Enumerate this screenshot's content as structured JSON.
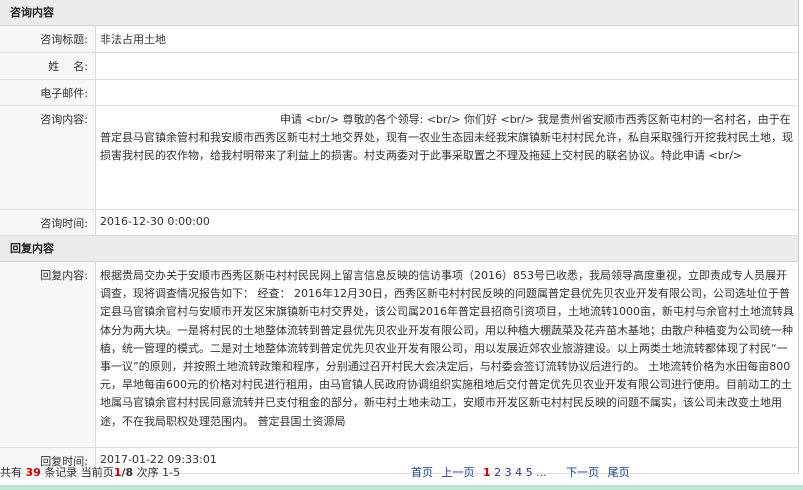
{
  "consult_section": {
    "header": "咨询内容",
    "title_label": "咨询标题:",
    "title_value": "非法占用土地",
    "name_label": "姓    名:",
    "name_value": "",
    "email_label": "电子邮件:",
    "email_value": "",
    "content_label": "咨询内容:",
    "content_value": "申请 <br/> 尊敬的各个领导: <br/> 你们好 <br/> 我是贵州省安顺市西秀区新屯村的一名村名，由于在普定县马官镇余管村和我安顺市西秀区新屯村土地交界处，现有一农业生态园未经我宋旗镇新屯村村民允许，私自采取强行开挖我村民土地，现损害我村民的农作物，给我村明带来了利益上的损害。村支两委对于此事采取置之不理及拖延上交村民的联名协议。特此申请 <br/>",
    "time_label": "咨询时间:",
    "time_value": "2016-12-30 0:00:00"
  },
  "reply_section": {
    "header": "回复内容",
    "content_label": "回复内容:",
    "content_value": "根据贵局交办关于安顺市西秀区新屯村村民民网上留言信息反映的信访事项（2016）853号已收悉，我局领导高度重视，立即责成专人员展开调查，现将调查情况报告如下： 经查： 2016年12月30日，西秀区新屯村村民反映的问题属普定县优先贝农业开发有限公司，公司选址位于普定县马官镇余官村与安顺市开发区宋旗镇新屯村交界处，该公司属2016年普定县招商引资项目，土地流转1000亩，新屯村与余官村土地流转具体分为两大块。一是将村民的土地整体流转到普定县优先贝农业开发有限公司，用以种植大棚蔬菜及花卉苗木基地；由散户种植变为公司统一种植，统一管理的模式。二是对土地整体流转到普定优先贝农业开发有限公司，用以发展近郊农业旅游建设。以上两类土地流转都体现了村民“一事一议”的原则，并按照土地流转政策和程序，分别通过召开村民大会决定后，与村委会签订流转协议后进行的。 土地流转价格为水田每亩800元，旱地每亩600元的价格对村民进行租用，由马官镇人民政府协调组织实施租地后交付普定优先贝农业开发有限公司进行使用。目前动工的土地属马官镇余官村村民同意流转并已支付租金的部分，新屯村土地未动工，安顺市开发区新屯村村民反映的问题不属实，该公司未改变土地用途，不在我局职权处理范围内。 普定县国土资源局",
    "time_label": "回复时间:",
    "time_value": "2017-01-22 09:33:01"
  },
  "pagination": {
    "prefix": "共有",
    "total": "39",
    "records_suffix": "条记录 当前页",
    "current": "1",
    "slash_total": "/8",
    "order_text": "次序 1-5",
    "first": "首页",
    "prev": "上一页",
    "pages": [
      "1",
      "2",
      "3",
      "4",
      "5"
    ],
    "ellipsis": "...",
    "next": "下一页",
    "last": "尾页"
  }
}
